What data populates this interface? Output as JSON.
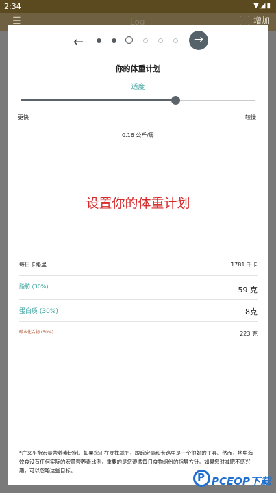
{
  "status_bar": {
    "time": "2:34",
    "icons": "▼◢▮"
  },
  "background_app": {
    "title": "Log",
    "add_label": "增加"
  },
  "dialog": {
    "back_arrow": "←",
    "next_arrow": "→",
    "steps": {
      "total": 6,
      "current_index": 2
    },
    "heading": "你的体重计划",
    "pace_label": "适度",
    "slider": {
      "value_fraction": 0.68,
      "left_label": "更快",
      "right_label": "较慢"
    },
    "rate": "0.16 公斤/周",
    "overlay_text": "设置你的体重计划",
    "nutrition": {
      "calories": {
        "label": "每日卡路里",
        "value": "1781 千卡"
      },
      "fat": {
        "label": "脂肪 (30%)",
        "value": "59 克"
      },
      "protein": {
        "label": "蛋白质 (30%)",
        "value": "8克"
      },
      "carbs": {
        "label": "碳水化合物 (50%)",
        "value": "223 克"
      }
    },
    "footnote": "*广义平衡宏量营养素比例。如果您正在寻找减肥，跟踪宏量和卡路里是一个很好的工具。然而，地中海饮食没有任何实际的宏量营养素比例，重要的是您遵循每日食物组份的指导方针。如果您对减肥不感兴趣，可以忽略这些目标。"
  },
  "watermark": {
    "text": "PCEOP下载",
    "mark": "P",
    "color": "#1f6fd1"
  },
  "colors": {
    "accent": "#3ba3a0",
    "slider": "#5c646a",
    "overlay": "#d62b2b",
    "carbs": "#b05a3a"
  }
}
